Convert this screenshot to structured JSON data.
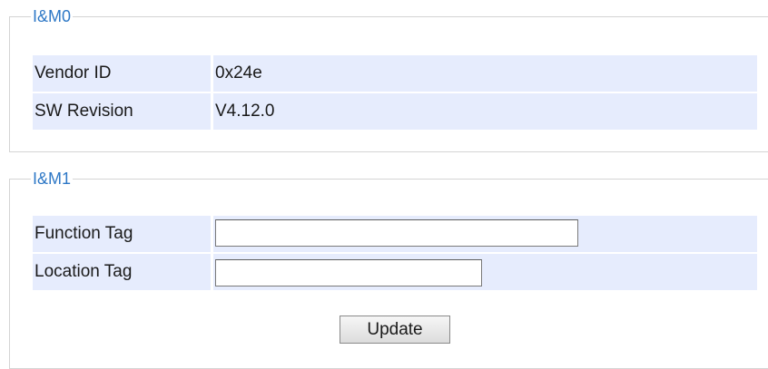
{
  "im0": {
    "legend": "I&M0",
    "rows": [
      {
        "label": "Vendor ID",
        "value": "0x24e"
      },
      {
        "label": "SW Revision",
        "value": "V4.12.0"
      }
    ]
  },
  "im1": {
    "legend": "I&M1",
    "function_tag": {
      "label": "Function Tag",
      "value": ""
    },
    "location_tag": {
      "label": "Location Tag",
      "value": ""
    },
    "update_label": "Update"
  },
  "colors": {
    "legend_text": "#2e78c6",
    "row_background": "#e6ecfd",
    "fieldset_border": "#d4d4d4"
  }
}
